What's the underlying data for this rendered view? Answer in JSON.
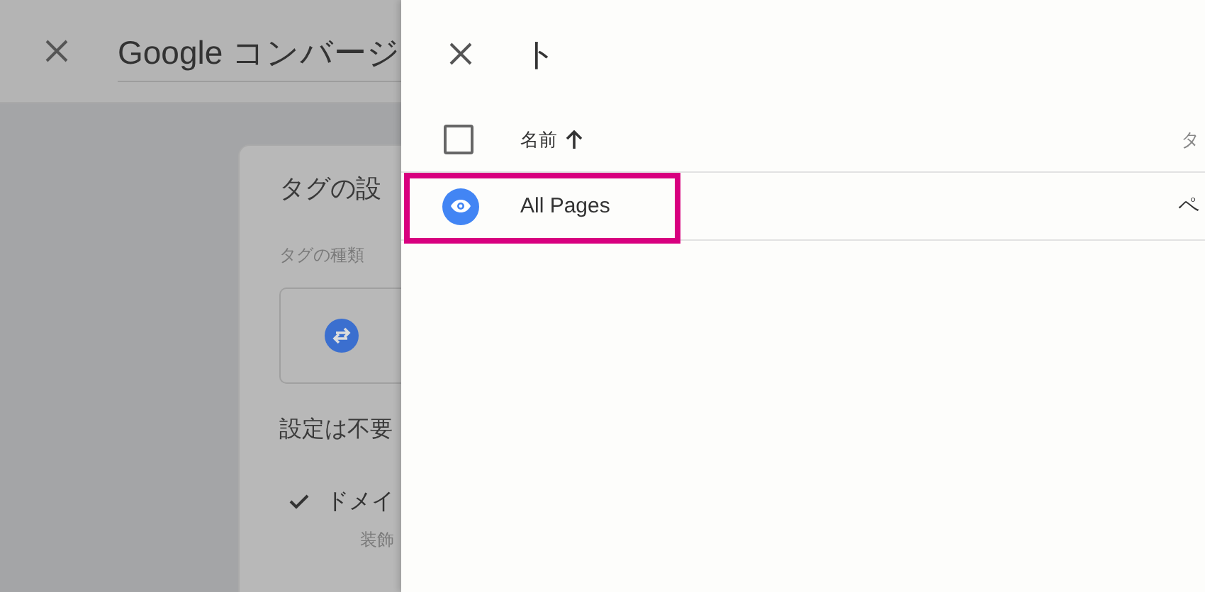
{
  "background_page": {
    "title": "Google コンバージ",
    "card": {
      "title": "タグの設",
      "type_label": "タグの種類",
      "note": "設定は不要",
      "check_item": {
        "label": "ドメイ",
        "checked": true
      },
      "sub_label": "装飾"
    }
  },
  "panel": {
    "title": "ト",
    "table": {
      "select_all": {
        "checked": false
      },
      "columns": [
        {
          "label": "名前",
          "sorted": true
        },
        {
          "label": "タ",
          "sorted": false
        }
      ],
      "rows": [
        {
          "cells": [
            "All Pages",
            "ペ"
          ],
          "highlighted": true
        }
      ]
    }
  }
}
